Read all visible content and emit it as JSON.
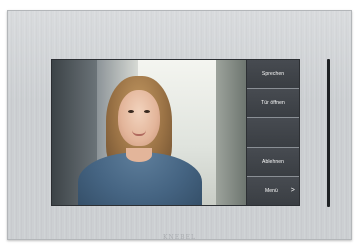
{
  "device": {
    "brand": "KNEBEL",
    "body_color": "#cfd2d5"
  },
  "screen": {
    "video_feed": "visitor-camera",
    "menu": {
      "buttons": [
        {
          "label": "Sprechen"
        },
        {
          "label": "Tür öffnen"
        },
        {
          "label": ""
        },
        {
          "label": "Ablehnen"
        },
        {
          "label": "Menü",
          "arrow": ">"
        }
      ],
      "background": "#3a3e43",
      "text_color": "#ffffff"
    }
  }
}
